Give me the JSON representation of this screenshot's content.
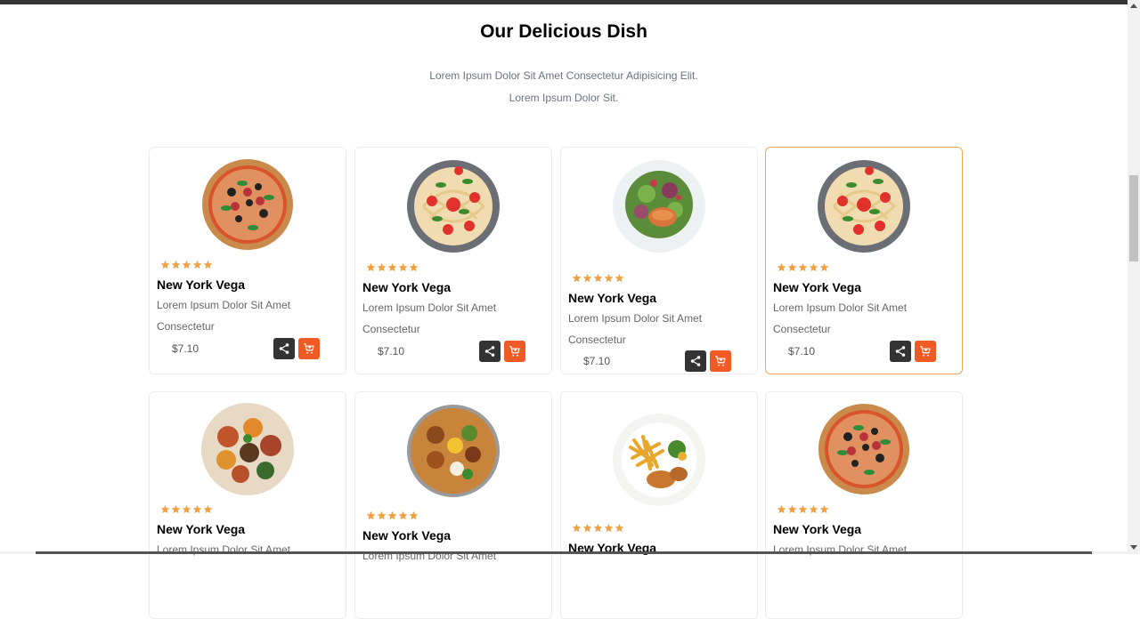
{
  "section": {
    "title": "Our Delicious Dish",
    "subtitle_line1": "Lorem Ipsum Dolor Sit Amet Consectetur Adipisicing Elit.",
    "subtitle_line2": "Lorem Ipsum Dolor Sit."
  },
  "colors": {
    "accent": "#f05a24",
    "star": "#f0a040",
    "share_bg": "#333333",
    "active_border": "#f2a65a"
  },
  "icons": {
    "share": "share-icon",
    "cart": "cart-plus-icon",
    "star": "star-icon"
  },
  "dishes": [
    {
      "image": "pizza",
      "rating": 5,
      "name": "New York Vega",
      "desc_line1": "Lorem Ipsum Dolor Sit Amet",
      "desc_line2": "Consectetur",
      "price": "$7.10"
    },
    {
      "image": "spaghetti",
      "rating": 5,
      "name": "New York Vega",
      "desc_line1": "Lorem Ipsum Dolor Sit Amet",
      "desc_line2": "Consectetur",
      "price": "$7.10"
    },
    {
      "image": "salmon-salad",
      "rating": 5,
      "name": "New York Vega",
      "desc_line1": "Lorem Ipsum Dolor Sit Amet",
      "desc_line2": "Consectetur",
      "price": "$7.10"
    },
    {
      "image": "spaghetti",
      "rating": 5,
      "name": "New York Vega",
      "desc_line1": "Lorem Ipsum Dolor Sit Amet",
      "desc_line2": "Consectetur",
      "price": "$7.10"
    },
    {
      "image": "platter",
      "rating": 5,
      "name": "New York Vega",
      "desc_line1": "Lorem Ipsum Dolor Sit Amet"
    },
    {
      "image": "curry-platter",
      "rating": 5,
      "name": "New York Vega",
      "desc_line1": "Lorem Ipsum Dolor Sit Amet"
    },
    {
      "image": "fries-chicken",
      "rating": 5,
      "name": "New York Vega"
    },
    {
      "image": "pizza",
      "rating": 5,
      "name": "New York Vega",
      "desc_line1": "Lorem Ipsum Dolor Sit Amet"
    }
  ]
}
